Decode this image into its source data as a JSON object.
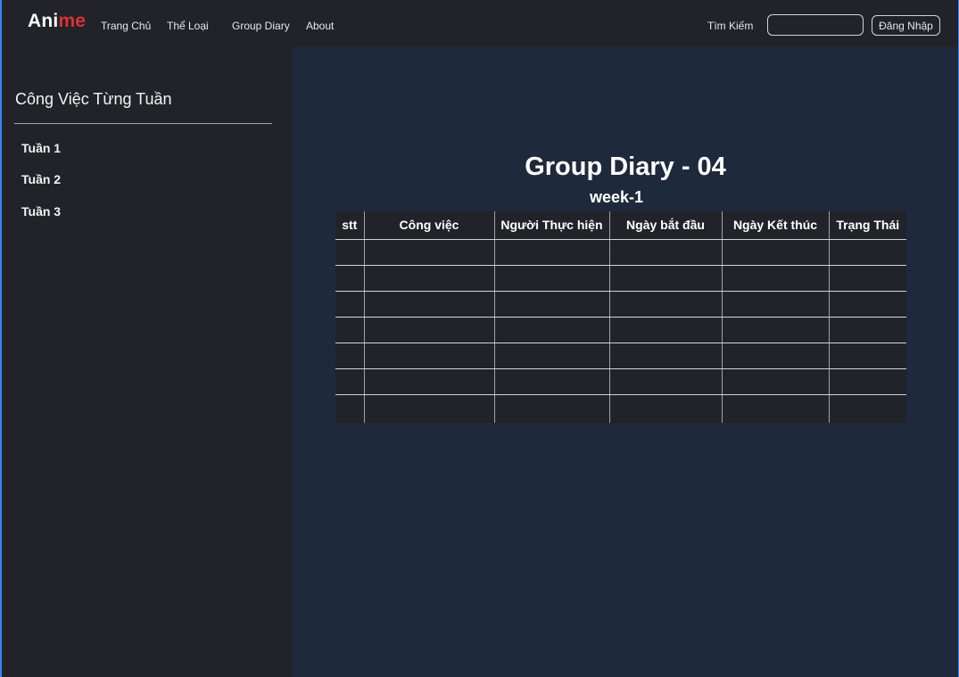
{
  "header": {
    "logo_part1": "Ani",
    "logo_part2": "me",
    "nav": [
      "Trang Chủ",
      "Thể Loại",
      "Group Diary",
      "About"
    ],
    "search_label": "Tìm Kiếm",
    "search_value": "",
    "login_label": "Đăng Nhập"
  },
  "sidebar": {
    "title": "Công Việc Từng Tuần",
    "items": [
      "Tuần 1",
      "Tuần 2",
      "Tuần 3"
    ]
  },
  "main": {
    "title": "Group Diary - 04",
    "subtitle": "week-1",
    "table": {
      "columns": [
        "stt",
        "Công việc",
        "Người Thực hiện",
        "Ngày bắt đầu",
        "Ngày Kết thúc",
        "Trạng Thái"
      ],
      "rows": [
        [
          "",
          "",
          "",
          "",
          "",
          ""
        ],
        [
          "",
          "",
          "",
          "",
          "",
          ""
        ],
        [
          "",
          "",
          "",
          "",
          "",
          ""
        ],
        [
          "",
          "",
          "",
          "",
          "",
          ""
        ],
        [
          "",
          "",
          "",
          "",
          "",
          ""
        ],
        [
          "",
          "",
          "",
          "",
          "",
          ""
        ],
        [
          "",
          "",
          "",
          "",
          "",
          ""
        ]
      ]
    }
  },
  "colors": {
    "page_bg": "#1e293b",
    "panel_bg": "#212328",
    "logo_accent": "#e03131",
    "frame_accent": "#3b82f6"
  }
}
